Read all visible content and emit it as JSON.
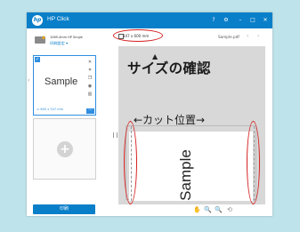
{
  "app": {
    "title": "HP Click",
    "logo_text": "hp"
  },
  "window_controls": [
    "?",
    "⚙",
    "–",
    "□",
    "✕"
  ],
  "sidebar": {
    "paper_info": "1069.4mm HP Single",
    "print_settings": "印刷設定 ▾",
    "warning_icon": "warning-icon",
    "thumbnail": {
      "text": "Sample",
      "size": "▭ 600 x 347 mm",
      "checkbox": "✓",
      "more": "···"
    },
    "prev": "‹",
    "add": "+",
    "print_button": "印刷"
  },
  "preview": {
    "size_label": "347 x 600 mm",
    "file_name": "Sample.pdf",
    "prev": "‹",
    "next": "›",
    "sheet_text": "Sample",
    "callout_arrow": "▲",
    "callout_size": "サイズの確認",
    "callout_cut": "←カット位置→",
    "tools": [
      "✋",
      "🔍",
      "🔍",
      "⟲"
    ]
  },
  "colors": {
    "accent": "#0a7fc9",
    "highlight": "#d62020",
    "background": "#bfe3ea"
  }
}
